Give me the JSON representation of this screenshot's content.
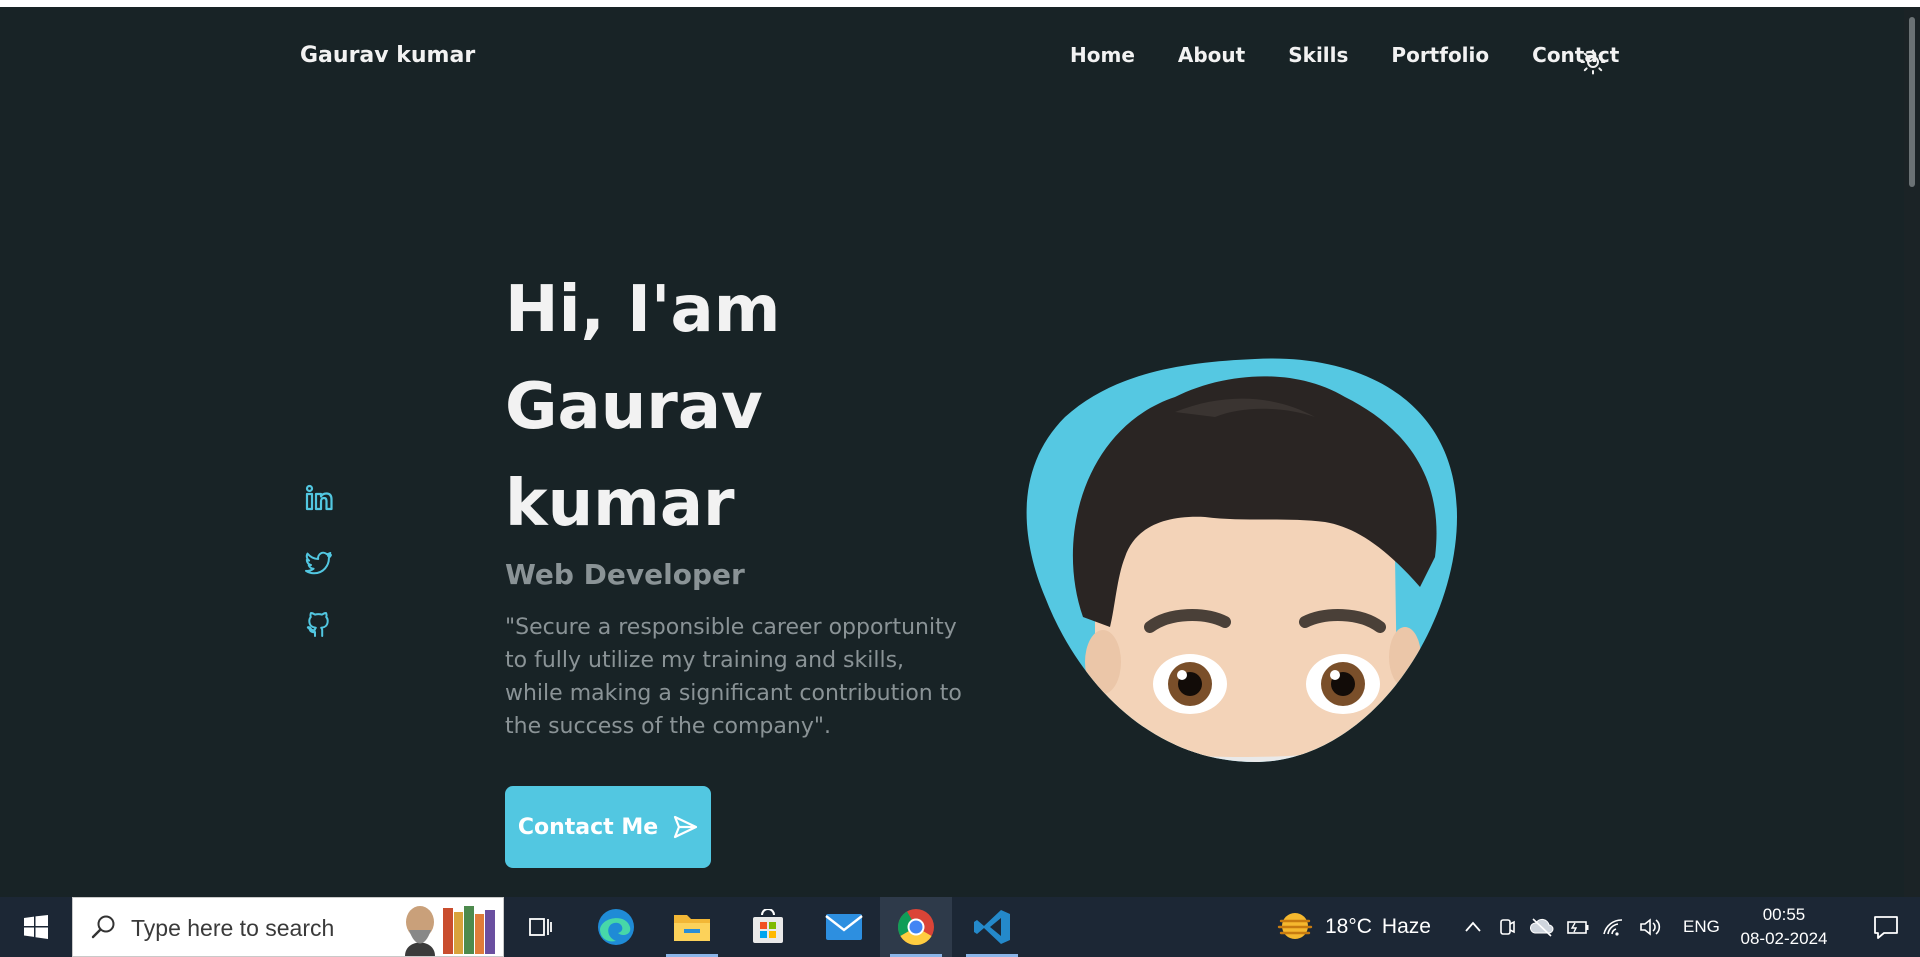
{
  "site": {
    "brand": "Gaurav kumar",
    "nav": [
      "Home",
      "About",
      "Skills",
      "Portfolio",
      "Contact"
    ],
    "theme_icon": "sun-icon"
  },
  "hero": {
    "title_line1": "Hi, I'am",
    "title_line2": "Gaurav",
    "title_line3": "kumar",
    "subtitle": "Web Developer",
    "description": "\"Secure a responsible career opportunity to fully utilize my training and skills, while making a significant contribution to the success of the company\".",
    "cta_label": "Contact Me",
    "accent_color": "#52c7e1"
  },
  "social": [
    "linkedin-icon",
    "twitter-icon",
    "github-icon"
  ],
  "taskbar": {
    "search_placeholder": "Type here to search",
    "weather_temp": "18°C",
    "weather_desc": "Haze",
    "language": "ENG",
    "time": "00:55",
    "date": "08-02-2024"
  }
}
